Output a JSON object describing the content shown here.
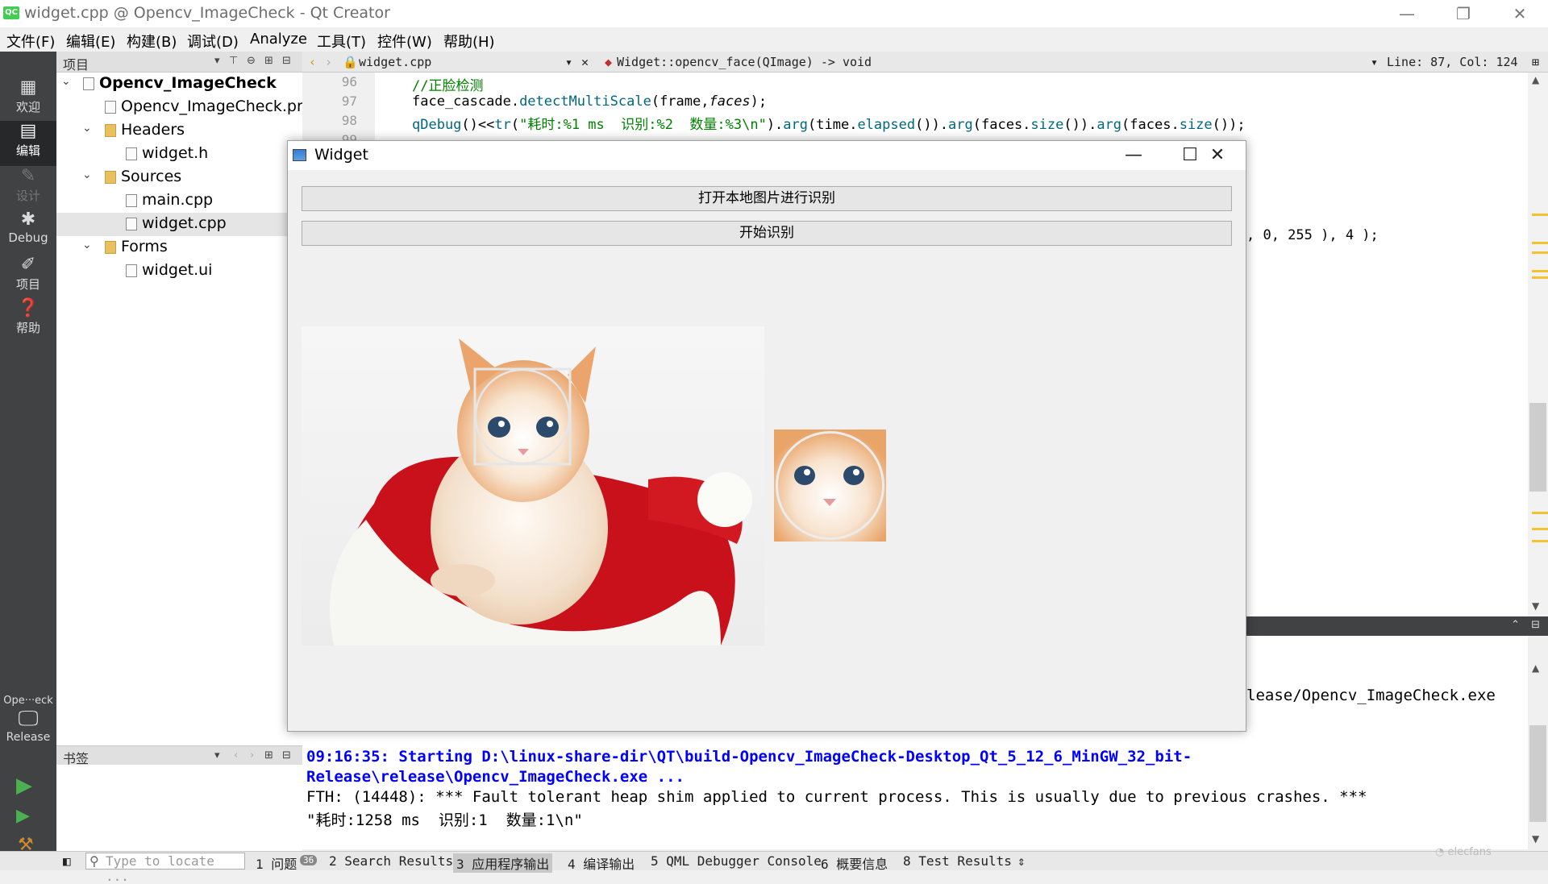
{
  "window": {
    "title": "widget.cpp @ Opencv_ImageCheck - Qt Creator",
    "app_icon": "QC",
    "minimize": "—",
    "restore": "❐",
    "close": "✕"
  },
  "menu": [
    "文件(F)",
    "编辑(E)",
    "构建(B)",
    "调试(D)",
    "Analyze",
    "工具(T)",
    "控件(W)",
    "帮助(H)"
  ],
  "modes": [
    {
      "label": "欢迎",
      "icon": "grid-icon",
      "glyph": "▦"
    },
    {
      "label": "编辑",
      "icon": "edit-icon",
      "glyph": "▤"
    },
    {
      "label": "设计",
      "icon": "pencil-icon",
      "glyph": "✎"
    },
    {
      "label": "Debug",
      "icon": "bug-icon",
      "glyph": "✱"
    },
    {
      "label": "项目",
      "icon": "wrench-icon",
      "glyph": "✐"
    },
    {
      "label": "帮助",
      "icon": "help-icon",
      "glyph": "❓"
    }
  ],
  "kit": {
    "project": "Ope···eck",
    "build": "Release"
  },
  "project_panel": {
    "header": "项目",
    "tree": [
      {
        "label": "Opencv_ImageCheck",
        "level": 0,
        "bold": true,
        "expanded": true
      },
      {
        "label": "Opencv_ImageCheck.pro",
        "level": 1
      },
      {
        "label": "Headers",
        "level": 1,
        "expanded": true
      },
      {
        "label": "widget.h",
        "level": 2
      },
      {
        "label": "Sources",
        "level": 1,
        "expanded": true
      },
      {
        "label": "main.cpp",
        "level": 2
      },
      {
        "label": "widget.cpp",
        "level": 2,
        "selected": true
      },
      {
        "label": "Forms",
        "level": 1,
        "expanded": true
      },
      {
        "label": "widget.ui",
        "level": 2
      }
    ]
  },
  "bookmarks": {
    "header": "书签"
  },
  "editor": {
    "file": "widget.cpp",
    "function": "Widget::opencv_face(QImage) -> void",
    "position": "Line: 87, Col: 124",
    "line_numbers": [
      "96",
      "97",
      "98",
      "99"
    ],
    "lines": {
      "l96": "//正脸检测",
      "l97_a": "face_cascade.",
      "l97_fn": "detectMultiScale",
      "l97_b": "(frame,",
      "l97_c": "faces",
      "l97_d": ");",
      "l98_a": "qDebug",
      "l98_b": "()<<",
      "l98_c": "tr",
      "l98_d": "(",
      "l98_str": "\"耗时:%1 ms  识别:%2  数量:%3\\n\"",
      "l98_e": ").",
      "l98_f": "arg",
      "l98_g": "(time.",
      "l98_h": "elapsed",
      "l98_i": "()).",
      "l98_j": "arg",
      "l98_k": "(faces.",
      "l98_l": "size",
      "l98_m": "()).",
      "l98_n": "arg",
      "l98_o": "(faces.",
      "l98_p": "size",
      "l98_q": "());",
      "partial": ", 0, 255 ), 4 );"
    }
  },
  "output": {
    "partial_path": "lease/Opencv_ImageCheck.exe",
    "line1": "09:16:35: Starting D:\\linux-share-dir\\QT\\build-Opencv_ImageCheck-Desktop_Qt_5_12_6_MinGW_32_bit-",
    "line2": "Release\\release\\Opencv_ImageCheck.exe ...",
    "line3": "FTH: (14448): *** Fault tolerant heap shim applied to current process. This is usually due to previous crashes. ***",
    "line4": "\"耗时:1258 ms  识别:1  数量:1\\n\""
  },
  "statusbar": {
    "locate_placeholder": "Type to locate ...",
    "tabs": [
      "1 问题",
      "2 Search Results",
      "3 应用程序输出",
      "4 编译输出",
      "5 QML Debugger Console",
      "6 概要信息",
      "8 Test Results"
    ],
    "issue_count": "36"
  },
  "widget_window": {
    "title": "Widget",
    "button_open": "打开本地图片进行识别",
    "button_start": "开始识别"
  }
}
